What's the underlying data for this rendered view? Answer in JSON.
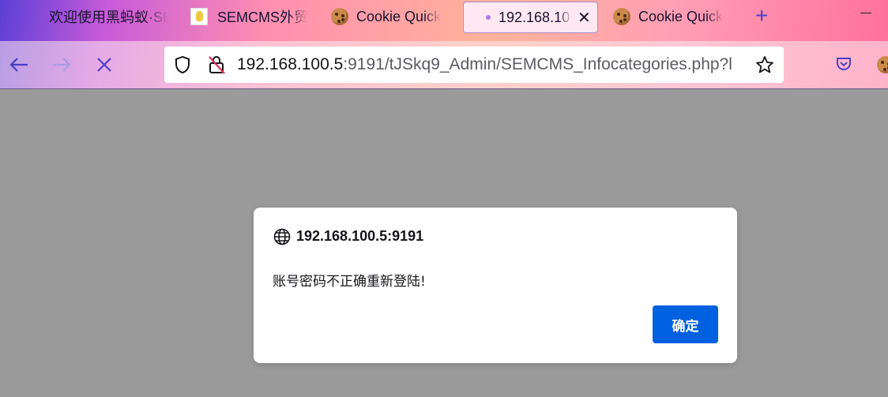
{
  "tabs": [
    {
      "label": "欢迎使用黑蚂蚁·SE",
      "favicon": "none"
    },
    {
      "label": "SEMCMS外贸",
      "favicon": "image-icon"
    },
    {
      "label": "Cookie Quick",
      "favicon": "cookie-icon"
    },
    {
      "label": "192.168.10",
      "favicon": "loading-dot",
      "active": true
    },
    {
      "label": "Cookie Quick",
      "favicon": "cookie-icon"
    }
  ],
  "navbar": {
    "url_host": "192.168.100.5",
    "url_rest": ":9191/tJSkq9_Admin/SEMCMS_Infocategories.php?l"
  },
  "dialog": {
    "origin": "192.168.100.5:9191",
    "message": "账号密码不正确重新登陆!",
    "ok_label": "确定"
  },
  "colors": {
    "accent": "#0061e0",
    "overlay": "#9a9a9b"
  }
}
